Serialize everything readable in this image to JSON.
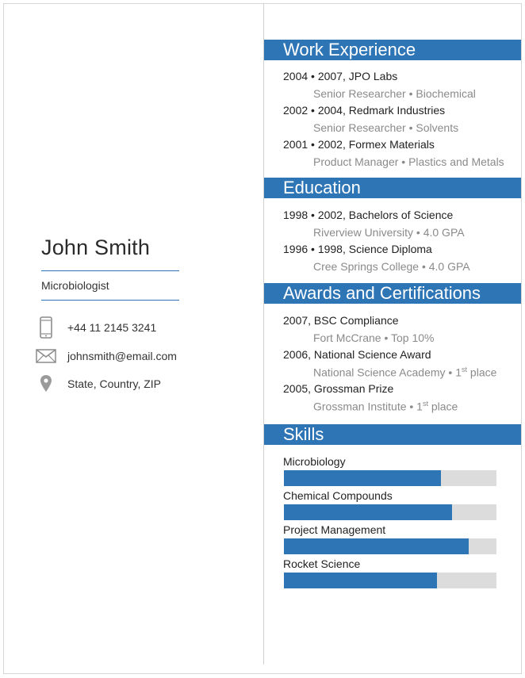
{
  "profile": {
    "name": "John Smith",
    "title": "Microbiologist"
  },
  "contact": {
    "phone": "+44 11 2145 3241",
    "email": "johnsmith@email.com",
    "location": "State, Country, ZIP"
  },
  "colors": {
    "accent": "#2e75b6",
    "muted_text": "#8a8a8a",
    "bar_track": "#dcdcdc"
  },
  "sections": {
    "work": {
      "heading": "Work Experience",
      "entries": [
        {
          "main": "2004 • 2007, JPO Labs",
          "sub": "Senior Researcher • Biochemical"
        },
        {
          "main": "2002 • 2004, Redmark Industries",
          "sub": "Senior Researcher • Solvents"
        },
        {
          "main": "2001 • 2002, Formex Materials",
          "sub": "Product Manager • Plastics and Metals"
        }
      ]
    },
    "education": {
      "heading": "Education",
      "entries": [
        {
          "main": "1998 • 2002, Bachelors of Science",
          "sub": "Riverview University • 4.0 GPA"
        },
        {
          "main": "1996 • 1998, Science Diploma",
          "sub": "Cree Springs College • 4.0 GPA"
        }
      ]
    },
    "awards": {
      "heading": "Awards and Certifications",
      "entries": [
        {
          "main": "2007, BSC Compliance",
          "sub": "Fort McCrane • Top 10%"
        },
        {
          "main": "2006, National Science Award",
          "sub": "National Science Academy • 1",
          "sub_sup": "st",
          "sub_after": " place"
        },
        {
          "main": "2005, Grossman Prize",
          "sub": "Grossman Institute • 1",
          "sub_sup": "st",
          "sub_after": " place"
        }
      ]
    },
    "skills": {
      "heading": "Skills",
      "items": [
        {
          "label": "Microbiology",
          "level": 0.74
        },
        {
          "label": "Chemical Compounds",
          "level": 0.79
        },
        {
          "label": "Project Management",
          "level": 0.87
        },
        {
          "label": "Rocket Science",
          "level": 0.72
        }
      ]
    }
  },
  "icons": {
    "phone": "phone-icon",
    "email": "envelope-icon",
    "location": "map-pin-icon"
  }
}
